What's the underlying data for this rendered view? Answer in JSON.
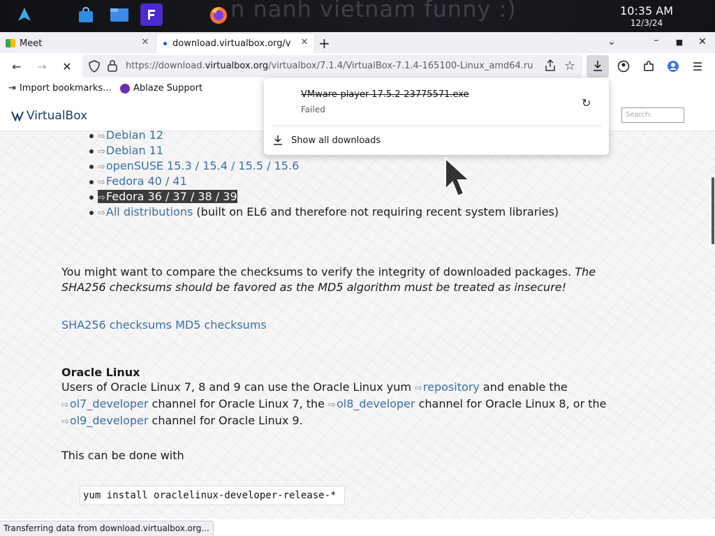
{
  "taskbar": {
    "wallpaper_text": "n nanh vietnam funny :)",
    "time": "10:35 AM",
    "date": "12/3/24"
  },
  "tabs": [
    {
      "label": "Meet",
      "icon": "meet-icon"
    },
    {
      "label": "download.virtualbox.org/vi",
      "icon": "loading-dot-icon"
    }
  ],
  "navbar": {
    "url_prefix": "https://download.",
    "url_domain": "virtualbox.org",
    "url_path": "/virtualbox/7.1.4/VirtualBox-7.1.4-165100-Linux_amd64.ru"
  },
  "bookmarks": [
    {
      "label": "Import bookmarks...",
      "icon": "import-icon"
    },
    {
      "label": "Ablaze Support",
      "icon": "ablaze-icon"
    }
  ],
  "downloads_panel": {
    "filename": "VMware-player-17.5.2-23775571.exe",
    "status": "Failed",
    "show_all": "Show all downloads"
  },
  "site": {
    "logo": "VirtualBox",
    "search_placeholder": "Search:"
  },
  "distributions": [
    {
      "label": "Debian 12",
      "note": ""
    },
    {
      "label": "Debian 11",
      "note": ""
    },
    {
      "label": "openSUSE 15.3 / 15.4 / 15.5 / 15.6",
      "note": ""
    },
    {
      "label": "Fedora 40 / 41",
      "note": ""
    },
    {
      "label": "Fedora 36 / 37 / 38 / 39",
      "note": "",
      "selected": true
    },
    {
      "label": "All distributions",
      "note": " (built on EL6 and therefore not requiring recent system libraries)"
    }
  ],
  "checksum_text": {
    "normal": "You might want to compare the checksums to verify the integrity of downloaded packages. ",
    "italic": "The SHA256 checksums should be favored as the MD5 algorithm must be treated as insecure!"
  },
  "checksum_links": {
    "sha256": "SHA256 checksums",
    "md5": "MD5 checksums"
  },
  "oracle": {
    "heading": "Oracle Linux",
    "p1": "Users of Oracle Linux 7, 8 and 9 can use the Oracle Linux yum ",
    "link_repo": "repository",
    "p2": " and enable the ",
    "link_ol7": "ol7_developer",
    "p3": " channel for Oracle Linux 7, the ",
    "link_ol8": "ol8_developer",
    "p4": " channel for Oracle Linux 8, or the ",
    "link_ol9": "ol9_developer",
    "p5": " channel for Oracle Linux 9.",
    "done_with": "This can be done with",
    "command": "yum install oraclelinux-developer-release-*"
  },
  "statusbar": "Transferring data from download.virtualbox.org...",
  "colors": {
    "link": "#3b6ea5",
    "selection": "#3b3b3b",
    "logo": "#1c3c66"
  }
}
